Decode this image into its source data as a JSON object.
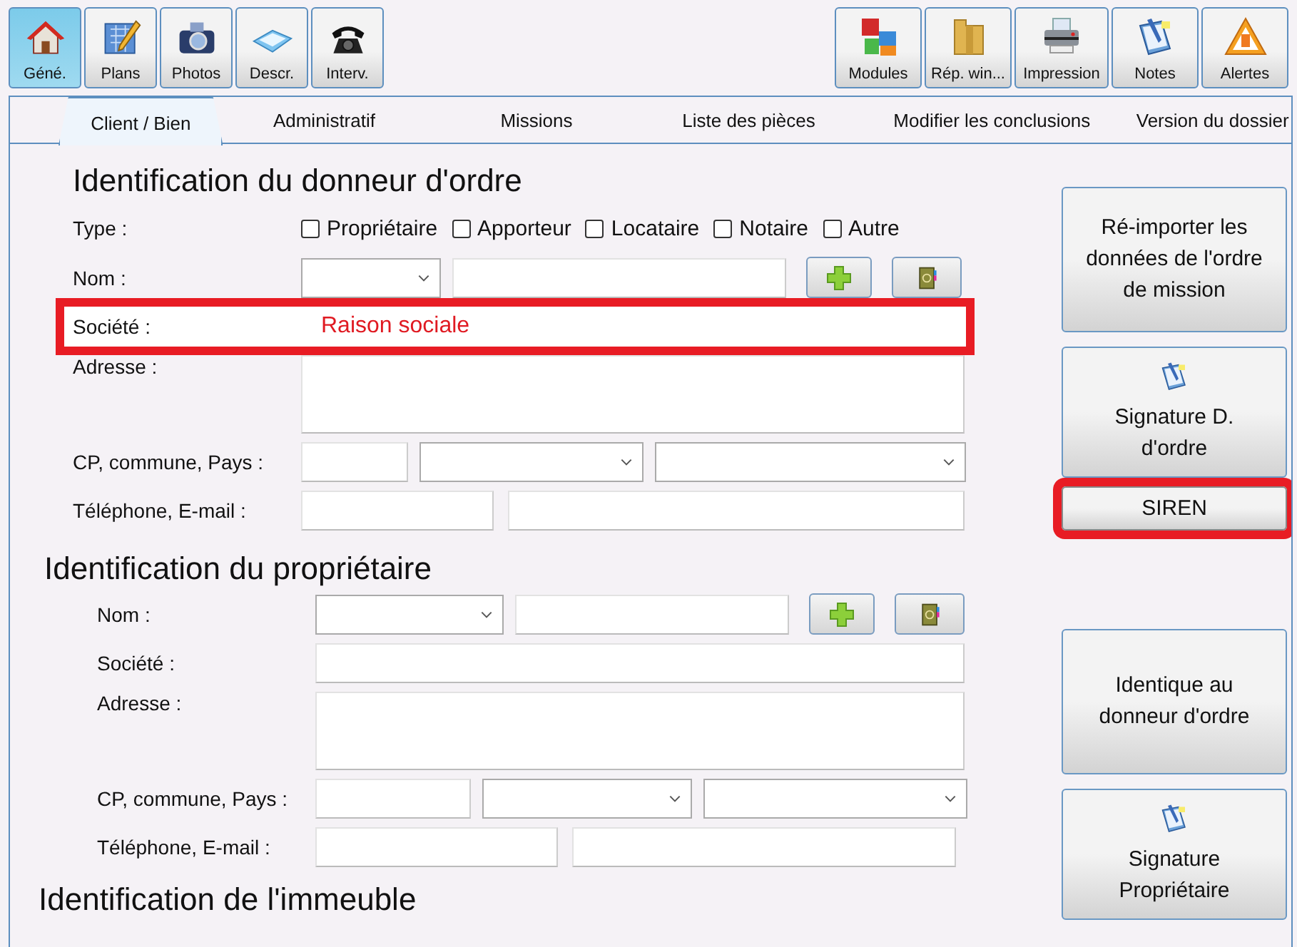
{
  "toolbar_left": [
    {
      "label": "Géné.",
      "selected": true
    },
    {
      "label": "Plans",
      "selected": false
    },
    {
      "label": "Photos",
      "selected": false
    },
    {
      "label": "Descr.",
      "selected": false
    },
    {
      "label": "Interv.",
      "selected": false
    }
  ],
  "toolbar_right": [
    {
      "label": "Modules"
    },
    {
      "label": "Rép. win..."
    },
    {
      "label": "Impression"
    },
    {
      "label": "Notes"
    },
    {
      "label": "Alertes"
    }
  ],
  "tabs": [
    {
      "label": "Client / Bien",
      "selected": true
    },
    {
      "label": "Administratif",
      "selected": false
    },
    {
      "label": "Missions",
      "selected": false
    },
    {
      "label": "Liste des pièces",
      "selected": false
    },
    {
      "label": "Modifier les conclusions",
      "selected": false
    },
    {
      "label": "Version du dossier",
      "selected": false
    }
  ],
  "sections": [
    {
      "title": "Identification du donneur d'ordre",
      "rows": [
        {
          "kind": "checkboxes",
          "label": "Type :",
          "options": [
            {
              "label": "Propriétaire",
              "checked": false
            },
            {
              "label": "Apporteur",
              "checked": false
            },
            {
              "label": "Locataire",
              "checked": false
            },
            {
              "label": "Notaire",
              "checked": false
            },
            {
              "label": "Autre",
              "checked": false
            }
          ]
        },
        {
          "kind": "name",
          "label": "Nom :",
          "highlighted": false
        },
        {
          "kind": "text",
          "label": "Société :",
          "value": "Raison sociale",
          "highlighted": true
        },
        {
          "kind": "textarea",
          "label": "Adresse :",
          "highlighted": false
        },
        {
          "kind": "address",
          "label": "CP, commune, Pays :",
          "highlighted": false
        },
        {
          "kind": "contact",
          "label": "Téléphone, E-mail :",
          "highlighted": false
        }
      ],
      "actions": [
        {
          "kind": "text",
          "label": "Ré-importer les données de l'ordre de mission",
          "highlighted": false
        },
        {
          "kind": "icon",
          "label": "Signature D. d'ordre",
          "highlighted": false
        },
        {
          "kind": "small",
          "label": "SIREN",
          "highlighted": true
        }
      ]
    },
    {
      "title": "Identification du propriétaire",
      "rows": [
        {
          "kind": "name",
          "label": "Nom :",
          "highlighted": false
        },
        {
          "kind": "text",
          "label": "Société :",
          "highlighted": false
        },
        {
          "kind": "textarea",
          "label": "Adresse :",
          "highlighted": false
        },
        {
          "kind": "address",
          "label": "CP, commune, Pays :",
          "highlighted": false
        },
        {
          "kind": "contact",
          "label": "Téléphone, E-mail :",
          "highlighted": false
        }
      ],
      "actions": [
        {
          "kind": "text",
          "label": "Identique au donneur d'ordre",
          "highlighted": false
        },
        {
          "kind": "icon",
          "label": "Signature Propriétaire",
          "highlighted": false
        }
      ]
    },
    {
      "title": "Identification de l'immeuble"
    }
  ]
}
